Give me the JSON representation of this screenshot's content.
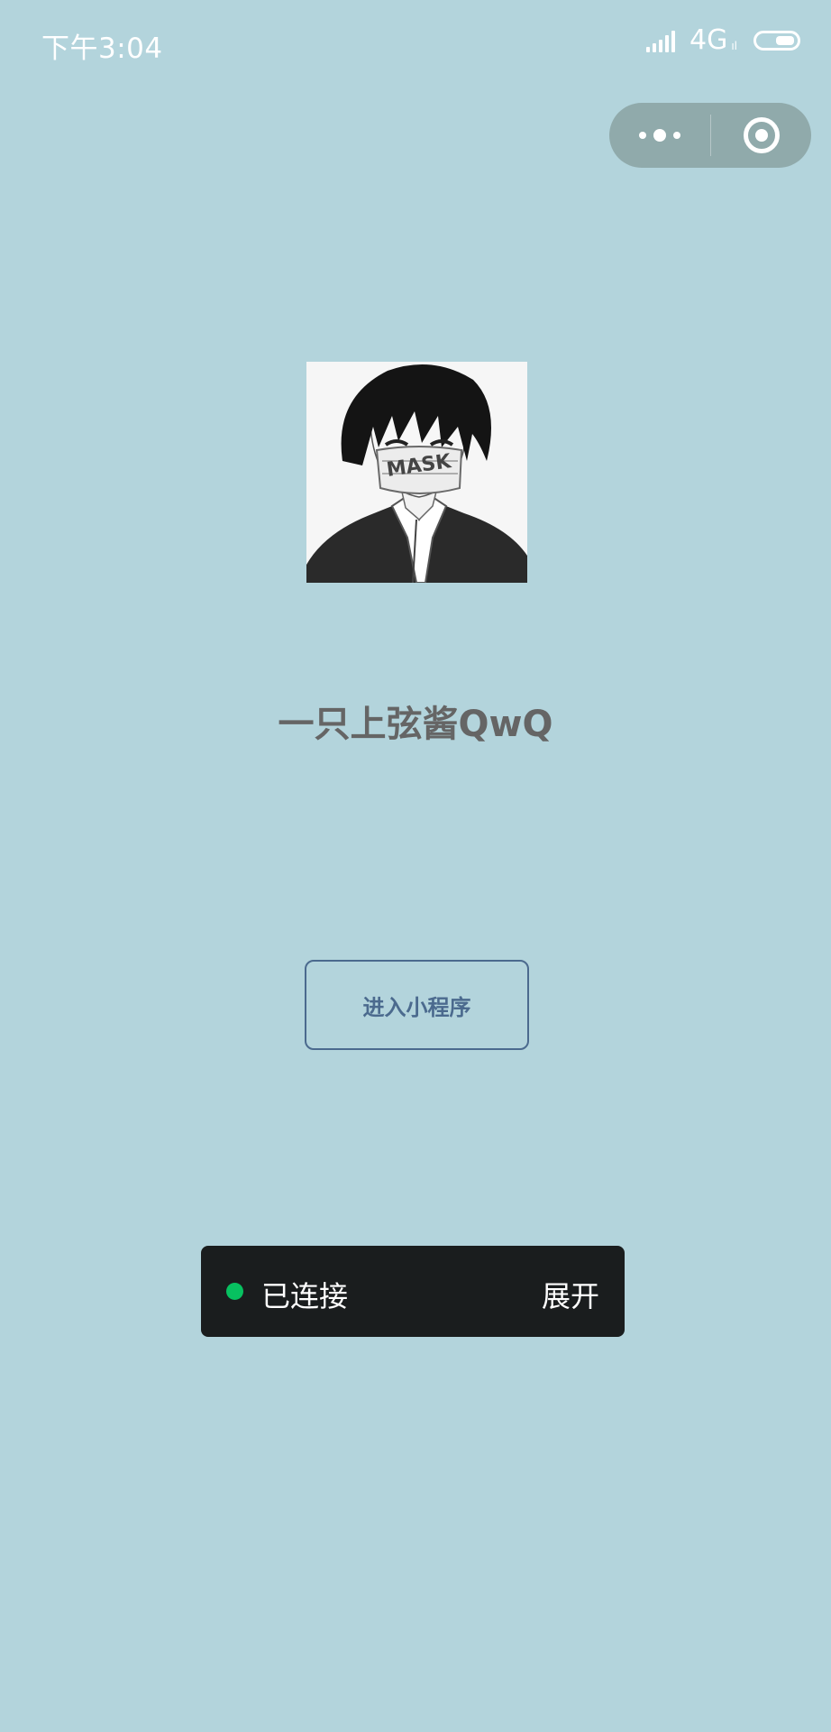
{
  "status_bar": {
    "time": "下午3:04",
    "network": "4G",
    "network_sub": "ıl"
  },
  "capsule": {
    "more_icon": "more-dots-icon",
    "close_icon": "target-circle-icon"
  },
  "profile": {
    "avatar_icon": "avatar-anime-boy-mask",
    "mask_text": "MASK",
    "nickname": "一只上弦酱QwQ"
  },
  "actions": {
    "enter_label": "进入小程序"
  },
  "connection": {
    "status": "已连接",
    "expand_label": "展开",
    "status_color": "#07c160"
  },
  "colors": {
    "background": "#b3d4dc",
    "button_border": "#4b6a8e",
    "toast_background": "#1a1d1e"
  }
}
